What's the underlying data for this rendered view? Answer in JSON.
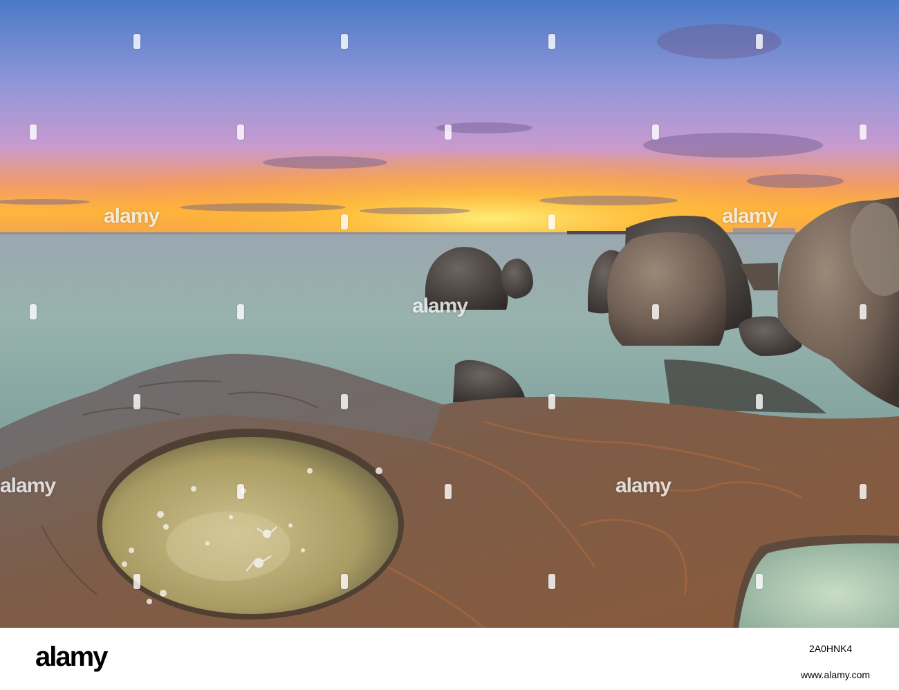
{
  "photo": {
    "subject": "Sunset seascape with smooth long-exposure sea, granite boulders and round tide pools in a flat rock",
    "colors": {
      "sky_top": "#4f79c4",
      "sky_mid": "#9c8dd8",
      "horizon_glow": "#ffd34a",
      "horizon_orange": "#ff9c2e",
      "sea": "#9fb4ae",
      "rock": "#7a5a45",
      "rock_dark": "#4a3a32",
      "pool": "#b8ad74"
    }
  },
  "watermark": {
    "text": "alamy",
    "icon": "alamy-a-mark"
  },
  "footer": {
    "logo": "alamy",
    "image_id": "2A0HNK4",
    "url": "www.alamy.com"
  }
}
